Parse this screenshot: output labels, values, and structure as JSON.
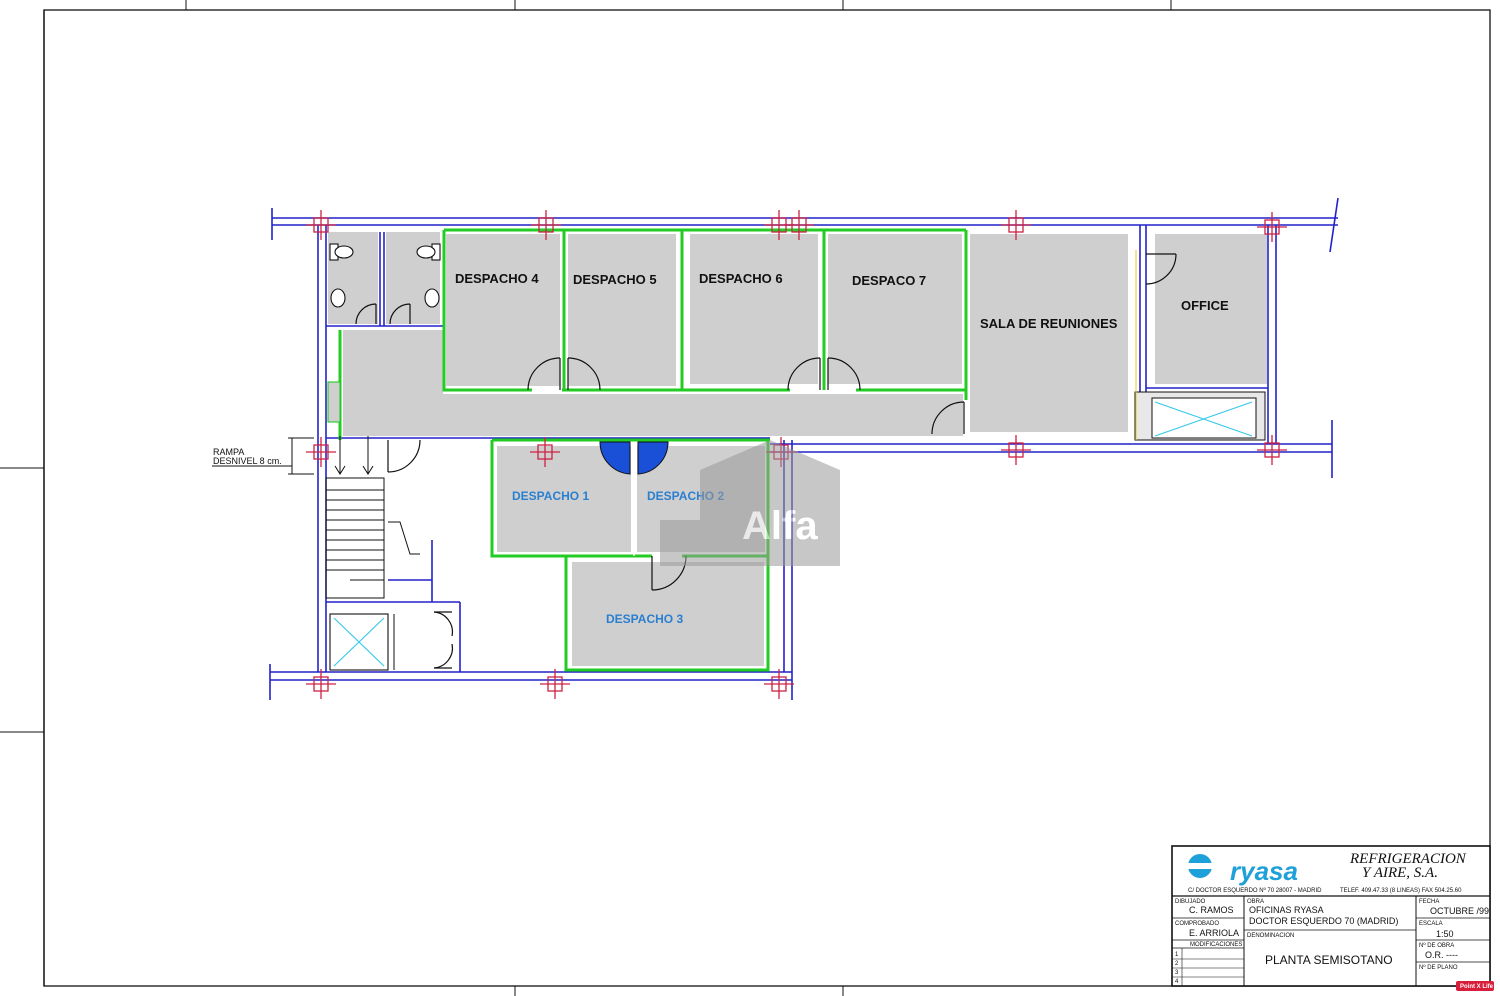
{
  "rooms": {
    "despacho_4": "DESPACHO 4",
    "despacho_5": "DESPACHO 5",
    "despacho_6": "DESPACHO 6",
    "despacho_7": "DESPACO 7",
    "sala_reuniones": "SALA DE REUNIONES",
    "office": "OFFICE",
    "despacho_1": "DESPACHO 1",
    "despacho_2": "DESPACHO 2",
    "despacho_3": "DESPACHO 3"
  },
  "annotations": {
    "rampa_line1": "RAMPA",
    "rampa_line2": "DESNIVEL 8 cm."
  },
  "title_block": {
    "brand": "ryasa",
    "company_line1": "REFRIGERACION",
    "company_line2": "Y AIRE, S.A.",
    "address": "C/ DOCTOR ESQUERDO Nº 70 28007 - MADRID",
    "phone": "TELEF. 409.47.33 (8 LINEAS) FAX 504.25.60",
    "dibujado_header": "DIBUJADO",
    "dibujado": "C. RAMOS",
    "comprobado_header": "COMPROBADO",
    "comprobado": "E. ARRIOLA",
    "modificaciones_header": "MODIFICACIONES",
    "mod_rows": [
      "1",
      "2",
      "3",
      "4"
    ],
    "obra_header": "OBRA",
    "obra_line1": "OFICINAS RYASA",
    "obra_line2": "DOCTOR ESQUERDO 70 (MADRID)",
    "denominacion_header": "DENOMINACION",
    "denominacion": "PLANTA SEMISOTANO",
    "fecha_header": "FECHA",
    "fecha": "OCTUBRE /99",
    "escala_header": "ESCALA",
    "escala": "1:50",
    "n_obra_header": "Nº DE OBRA",
    "n_obra": "O.R. ----",
    "n_plano_header": "Nº DE PLANO"
  },
  "watermark": {
    "text": "Alfa"
  },
  "badge": {
    "text": "Point X Life"
  },
  "colors": {
    "wall": "#2222cc",
    "partition": "#22cc22",
    "floor": "#cfcfcf",
    "column": "#cc2244",
    "brand": "#1ea0d8",
    "door_fill": "#1a4fd8"
  }
}
